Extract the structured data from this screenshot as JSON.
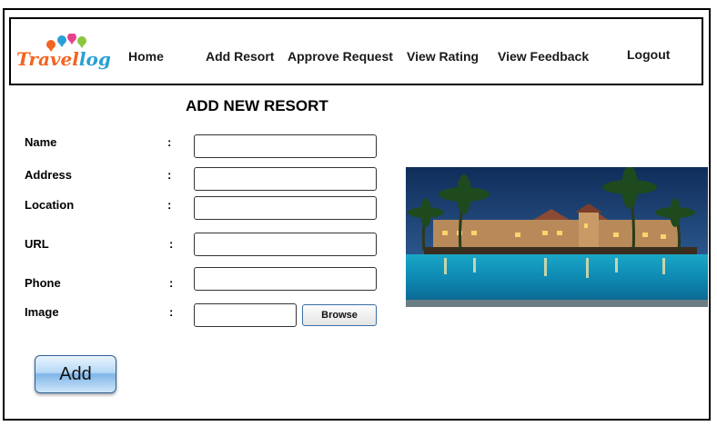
{
  "brand": {
    "name_part1": "Travel",
    "name_part2": "log",
    "colors": {
      "orange": "#f26522",
      "blue": "#2a9fd6",
      "pink": "#e8418a",
      "green": "#8cc63f"
    }
  },
  "nav": {
    "home": "Home",
    "add_resort": "Add Resort",
    "approve_request": "Approve Request",
    "view_rating": "View Rating",
    "view_feedback": "View Feedback",
    "logout": "Logout"
  },
  "page_title": "ADD NEW RESORT",
  "form": {
    "separator": ":",
    "name_label": "Name",
    "address_label": "Address",
    "location_label": "Location",
    "url_label": "URL",
    "phone_label": "Phone",
    "image_label": "Image",
    "browse_label": "Browse",
    "submit_label": "Add"
  },
  "image": {
    "subject": "resort-pool-night-photo"
  },
  "colors": {
    "button_border": "#2d5f95",
    "browse_border": "#3a6ea5"
  }
}
